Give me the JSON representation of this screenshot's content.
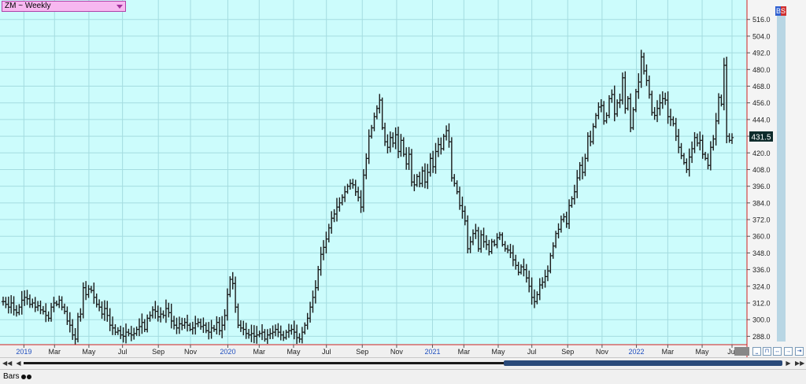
{
  "symbol": {
    "label": "ZM ~ Weekly"
  },
  "badge": {
    "label": "BS"
  },
  "last_price": "431.5",
  "status": {
    "mode_label": "Bars"
  },
  "colors": {
    "background": "#ccfcfc",
    "grid": "#a4dce0",
    "bars": "#1a1a1a",
    "price_tag": "#0d2a2a",
    "axis_line": "#d02020",
    "year_label": "#2050c0"
  },
  "chart_data": {
    "type": "ohlc",
    "ylim": [
      282,
      530
    ],
    "yticks": [
      288,
      300,
      312,
      324,
      336,
      348,
      360,
      372,
      384,
      396,
      408,
      420,
      432,
      444,
      456,
      468,
      480,
      492,
      504,
      516
    ],
    "ytick_labels": [
      "288.0",
      "300.0",
      "312.0",
      "324.0",
      "336.0",
      "348.0",
      "360.0",
      "372.0",
      "384.0",
      "396.0",
      "408.0",
      "420.0",
      "432.0",
      "444.0",
      "456.0",
      "468.0",
      "480.0",
      "492.0",
      "504.0",
      "516.0"
    ],
    "xticks": [
      {
        "label": "2019",
        "pos": 0.032,
        "year": true
      },
      {
        "label": "Mar",
        "pos": 0.073,
        "year": false
      },
      {
        "label": "May",
        "pos": 0.119,
        "year": false
      },
      {
        "label": "Jul",
        "pos": 0.164,
        "year": false
      },
      {
        "label": "Sep",
        "pos": 0.212,
        "year": false
      },
      {
        "label": "Nov",
        "pos": 0.255,
        "year": false
      },
      {
        "label": "2020",
        "pos": 0.305,
        "year": true
      },
      {
        "label": "Mar",
        "pos": 0.347,
        "year": false
      },
      {
        "label": "May",
        "pos": 0.393,
        "year": false
      },
      {
        "label": "Jul",
        "pos": 0.437,
        "year": false
      },
      {
        "label": "Sep",
        "pos": 0.485,
        "year": false
      },
      {
        "label": "Nov",
        "pos": 0.531,
        "year": false
      },
      {
        "label": "2021",
        "pos": 0.579,
        "year": true
      },
      {
        "label": "Mar",
        "pos": 0.621,
        "year": false
      },
      {
        "label": "May",
        "pos": 0.667,
        "year": false
      },
      {
        "label": "Jul",
        "pos": 0.712,
        "year": false
      },
      {
        "label": "Sep",
        "pos": 0.76,
        "year": false
      },
      {
        "label": "Nov",
        "pos": 0.806,
        "year": false
      },
      {
        "label": "2022",
        "pos": 0.852,
        "year": true
      },
      {
        "label": "Mar",
        "pos": 0.894,
        "year": false
      },
      {
        "label": "May",
        "pos": 0.94,
        "year": false
      },
      {
        "label": "Jul",
        "pos": 0.98,
        "year": false
      }
    ],
    "weekly_close": [
      313,
      311,
      309,
      312,
      307,
      305,
      309,
      314,
      316,
      315,
      311,
      312,
      309,
      310,
      307,
      306,
      303,
      301,
      309,
      312,
      311,
      314,
      309,
      306,
      299,
      296,
      289,
      286,
      302,
      304,
      323,
      318,
      322,
      321,
      316,
      311,
      309,
      304,
      308,
      303,
      296,
      294,
      291,
      292,
      289,
      288,
      291,
      290,
      289,
      290,
      293,
      295,
      298,
      293,
      301,
      303,
      307,
      306,
      302,
      304,
      303,
      308,
      305,
      299,
      296,
      294,
      297,
      296,
      298,
      296,
      293,
      294,
      297,
      298,
      295,
      296,
      292,
      291,
      294,
      293,
      298,
      292,
      296,
      303,
      318,
      329,
      326,
      309,
      296,
      294,
      293,
      290,
      289,
      290,
      288,
      289,
      290,
      291,
      286,
      289,
      290,
      291,
      293,
      291,
      289,
      287,
      291,
      292,
      293,
      291,
      287,
      286,
      291,
      296,
      301,
      309,
      316,
      323,
      336,
      347,
      352,
      358,
      366,
      373,
      376,
      381,
      384,
      388,
      392,
      396,
      398,
      397,
      392,
      388,
      381,
      404,
      416,
      432,
      438,
      446,
      452,
      458,
      438,
      428,
      424,
      431,
      427,
      433,
      421,
      429,
      419,
      412,
      419,
      399,
      397,
      403,
      398,
      407,
      399,
      406,
      416,
      410,
      421,
      426,
      423,
      432,
      436,
      428,
      402,
      398,
      392,
      382,
      378,
      371,
      351,
      356,
      362,
      364,
      351,
      361,
      356,
      354,
      349,
      356,
      354,
      359,
      361,
      354,
      351,
      350,
      348,
      343,
      339,
      334,
      338,
      336,
      330,
      324,
      316,
      313,
      318,
      325,
      327,
      331,
      335,
      346,
      353,
      362,
      365,
      372,
      374,
      369,
      382,
      387,
      392,
      402,
      411,
      406,
      416,
      432,
      428,
      439,
      447,
      453,
      454,
      443,
      447,
      459,
      462,
      448,
      456,
      458,
      474,
      452,
      459,
      438,
      451,
      464,
      471,
      489,
      479,
      472,
      462,
      449,
      447,
      452,
      456,
      459,
      458,
      446,
      444,
      441,
      432,
      424,
      418,
      413,
      408,
      417,
      423,
      431,
      427,
      429,
      419,
      416,
      411,
      424,
      430,
      443,
      460,
      455,
      483,
      432,
      429,
      431
    ]
  }
}
